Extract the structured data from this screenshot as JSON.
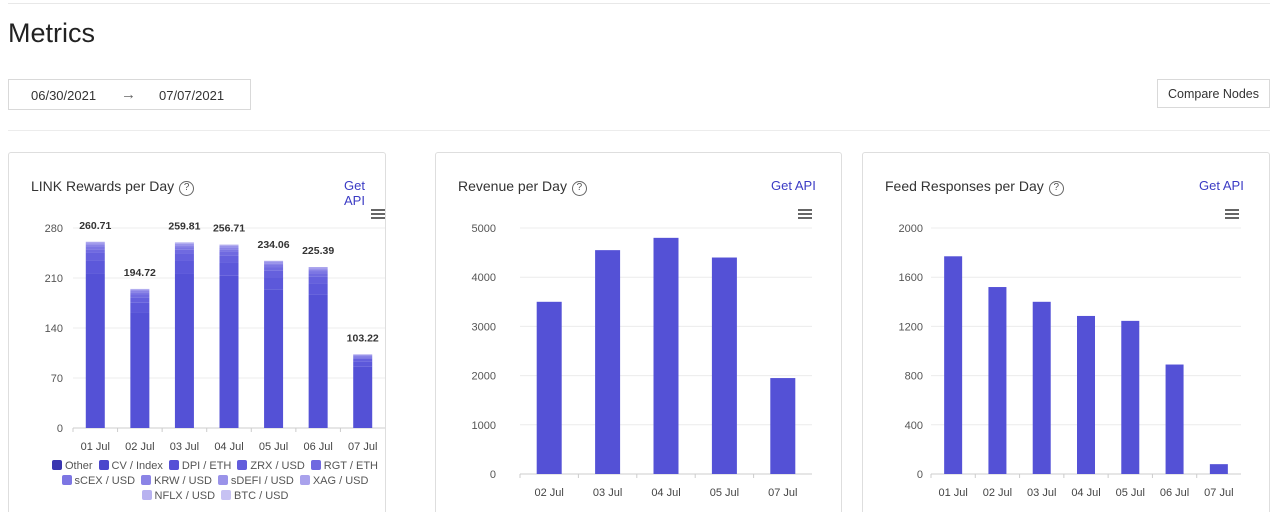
{
  "page": {
    "title": "Metrics"
  },
  "date_range": {
    "start": "06/30/2021",
    "arrow": "→",
    "end": "07/07/2021"
  },
  "compare_button": "Compare Nodes",
  "link_rewards": {
    "title": "LINK Rewards per Day",
    "help": "?",
    "api_link": "Get API",
    "legend": [
      {
        "label": "Other",
        "color": "#3a36b0"
      },
      {
        "label": "CV / Index",
        "color": "#4b46cc"
      },
      {
        "label": "DPI / ETH",
        "color": "#5650d6"
      },
      {
        "label": "ZRX / USD",
        "color": "#625cdc"
      },
      {
        "label": "RGT / ETH",
        "color": "#7068e0"
      },
      {
        "label": "sCEX / USD",
        "color": "#7d76e3"
      },
      {
        "label": "KRW / USD",
        "color": "#8b84e6"
      },
      {
        "label": "sDEFI / USD",
        "color": "#9a93e9"
      },
      {
        "label": "XAG / USD",
        "color": "#a9a2ec"
      },
      {
        "label": "NFLX / USD",
        "color": "#b8b2f0"
      },
      {
        "label": "BTC / USD",
        "color": "#c7c2f3"
      }
    ]
  },
  "revenue": {
    "title": "Revenue per Day",
    "help": "?",
    "api_link": "Get API"
  },
  "feed_responses": {
    "title": "Feed Responses per Day",
    "help": "?",
    "api_link": "Get API"
  },
  "chart_data": [
    {
      "type": "bar",
      "title": "LINK Rewards per Day",
      "categories": [
        "01 Jul",
        "02 Jul",
        "03 Jul",
        "04 Jul",
        "05 Jul",
        "06 Jul",
        "07 Jul"
      ],
      "values": [
        260.71,
        194.72,
        259.81,
        256.71,
        234.06,
        225.39,
        103.22
      ],
      "data_labels": [
        "260.71",
        "194.72",
        "259.81",
        "256.71",
        "234.06",
        "225.39",
        "103.22"
      ],
      "stacked": true,
      "yticks": [
        "0",
        "70",
        "140",
        "210",
        "280"
      ],
      "ylim": [
        0,
        280
      ],
      "grid": true
    },
    {
      "type": "bar",
      "title": "Revenue per Day",
      "categories": [
        "02 Jul",
        "03 Jul",
        "04 Jul",
        "05 Jul",
        "07 Jul"
      ],
      "values": [
        3500,
        4550,
        4800,
        4400,
        1950
      ],
      "yticks": [
        "0",
        "1000",
        "2000",
        "3000",
        "4000",
        "5000"
      ],
      "ylim": [
        0,
        5000
      ],
      "grid": true
    },
    {
      "type": "bar",
      "title": "Feed Responses per Day",
      "categories": [
        "01 Jul",
        "02 Jul",
        "03 Jul",
        "04 Jul",
        "05 Jul",
        "06 Jul",
        "07 Jul"
      ],
      "values": [
        1770,
        1520,
        1400,
        1285,
        1245,
        890,
        80
      ],
      "yticks": [
        "0",
        "400",
        "800",
        "1200",
        "1600",
        "2000"
      ],
      "ylim": [
        0,
        2000
      ],
      "grid": true
    }
  ]
}
